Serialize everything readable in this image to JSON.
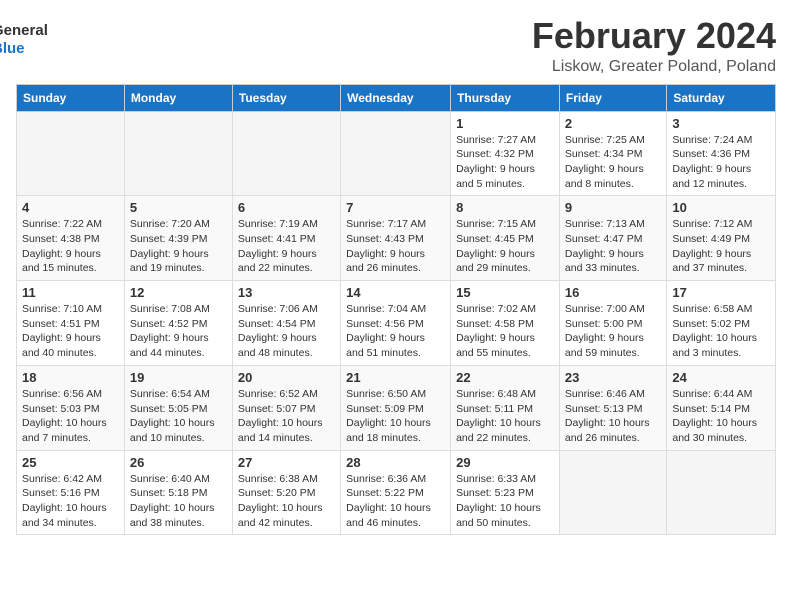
{
  "logo": {
    "line1": "General",
    "line2": "Blue"
  },
  "title": "February 2024",
  "subtitle": "Liskow, Greater Poland, Poland",
  "days_of_week": [
    "Sunday",
    "Monday",
    "Tuesday",
    "Wednesday",
    "Thursday",
    "Friday",
    "Saturday"
  ],
  "weeks": [
    [
      {
        "day": "",
        "info": ""
      },
      {
        "day": "",
        "info": ""
      },
      {
        "day": "",
        "info": ""
      },
      {
        "day": "",
        "info": ""
      },
      {
        "day": "1",
        "info": "Sunrise: 7:27 AM\nSunset: 4:32 PM\nDaylight: 9 hours\nand 5 minutes."
      },
      {
        "day": "2",
        "info": "Sunrise: 7:25 AM\nSunset: 4:34 PM\nDaylight: 9 hours\nand 8 minutes."
      },
      {
        "day": "3",
        "info": "Sunrise: 7:24 AM\nSunset: 4:36 PM\nDaylight: 9 hours\nand 12 minutes."
      }
    ],
    [
      {
        "day": "4",
        "info": "Sunrise: 7:22 AM\nSunset: 4:38 PM\nDaylight: 9 hours\nand 15 minutes."
      },
      {
        "day": "5",
        "info": "Sunrise: 7:20 AM\nSunset: 4:39 PM\nDaylight: 9 hours\nand 19 minutes."
      },
      {
        "day": "6",
        "info": "Sunrise: 7:19 AM\nSunset: 4:41 PM\nDaylight: 9 hours\nand 22 minutes."
      },
      {
        "day": "7",
        "info": "Sunrise: 7:17 AM\nSunset: 4:43 PM\nDaylight: 9 hours\nand 26 minutes."
      },
      {
        "day": "8",
        "info": "Sunrise: 7:15 AM\nSunset: 4:45 PM\nDaylight: 9 hours\nand 29 minutes."
      },
      {
        "day": "9",
        "info": "Sunrise: 7:13 AM\nSunset: 4:47 PM\nDaylight: 9 hours\nand 33 minutes."
      },
      {
        "day": "10",
        "info": "Sunrise: 7:12 AM\nSunset: 4:49 PM\nDaylight: 9 hours\nand 37 minutes."
      }
    ],
    [
      {
        "day": "11",
        "info": "Sunrise: 7:10 AM\nSunset: 4:51 PM\nDaylight: 9 hours\nand 40 minutes."
      },
      {
        "day": "12",
        "info": "Sunrise: 7:08 AM\nSunset: 4:52 PM\nDaylight: 9 hours\nand 44 minutes."
      },
      {
        "day": "13",
        "info": "Sunrise: 7:06 AM\nSunset: 4:54 PM\nDaylight: 9 hours\nand 48 minutes."
      },
      {
        "day": "14",
        "info": "Sunrise: 7:04 AM\nSunset: 4:56 PM\nDaylight: 9 hours\nand 51 minutes."
      },
      {
        "day": "15",
        "info": "Sunrise: 7:02 AM\nSunset: 4:58 PM\nDaylight: 9 hours\nand 55 minutes."
      },
      {
        "day": "16",
        "info": "Sunrise: 7:00 AM\nSunset: 5:00 PM\nDaylight: 9 hours\nand 59 minutes."
      },
      {
        "day": "17",
        "info": "Sunrise: 6:58 AM\nSunset: 5:02 PM\nDaylight: 10 hours\nand 3 minutes."
      }
    ],
    [
      {
        "day": "18",
        "info": "Sunrise: 6:56 AM\nSunset: 5:03 PM\nDaylight: 10 hours\nand 7 minutes."
      },
      {
        "day": "19",
        "info": "Sunrise: 6:54 AM\nSunset: 5:05 PM\nDaylight: 10 hours\nand 10 minutes."
      },
      {
        "day": "20",
        "info": "Sunrise: 6:52 AM\nSunset: 5:07 PM\nDaylight: 10 hours\nand 14 minutes."
      },
      {
        "day": "21",
        "info": "Sunrise: 6:50 AM\nSunset: 5:09 PM\nDaylight: 10 hours\nand 18 minutes."
      },
      {
        "day": "22",
        "info": "Sunrise: 6:48 AM\nSunset: 5:11 PM\nDaylight: 10 hours\nand 22 minutes."
      },
      {
        "day": "23",
        "info": "Sunrise: 6:46 AM\nSunset: 5:13 PM\nDaylight: 10 hours\nand 26 minutes."
      },
      {
        "day": "24",
        "info": "Sunrise: 6:44 AM\nSunset: 5:14 PM\nDaylight: 10 hours\nand 30 minutes."
      }
    ],
    [
      {
        "day": "25",
        "info": "Sunrise: 6:42 AM\nSunset: 5:16 PM\nDaylight: 10 hours\nand 34 minutes."
      },
      {
        "day": "26",
        "info": "Sunrise: 6:40 AM\nSunset: 5:18 PM\nDaylight: 10 hours\nand 38 minutes."
      },
      {
        "day": "27",
        "info": "Sunrise: 6:38 AM\nSunset: 5:20 PM\nDaylight: 10 hours\nand 42 minutes."
      },
      {
        "day": "28",
        "info": "Sunrise: 6:36 AM\nSunset: 5:22 PM\nDaylight: 10 hours\nand 46 minutes."
      },
      {
        "day": "29",
        "info": "Sunrise: 6:33 AM\nSunset: 5:23 PM\nDaylight: 10 hours\nand 50 minutes."
      },
      {
        "day": "",
        "info": ""
      },
      {
        "day": "",
        "info": ""
      }
    ]
  ]
}
